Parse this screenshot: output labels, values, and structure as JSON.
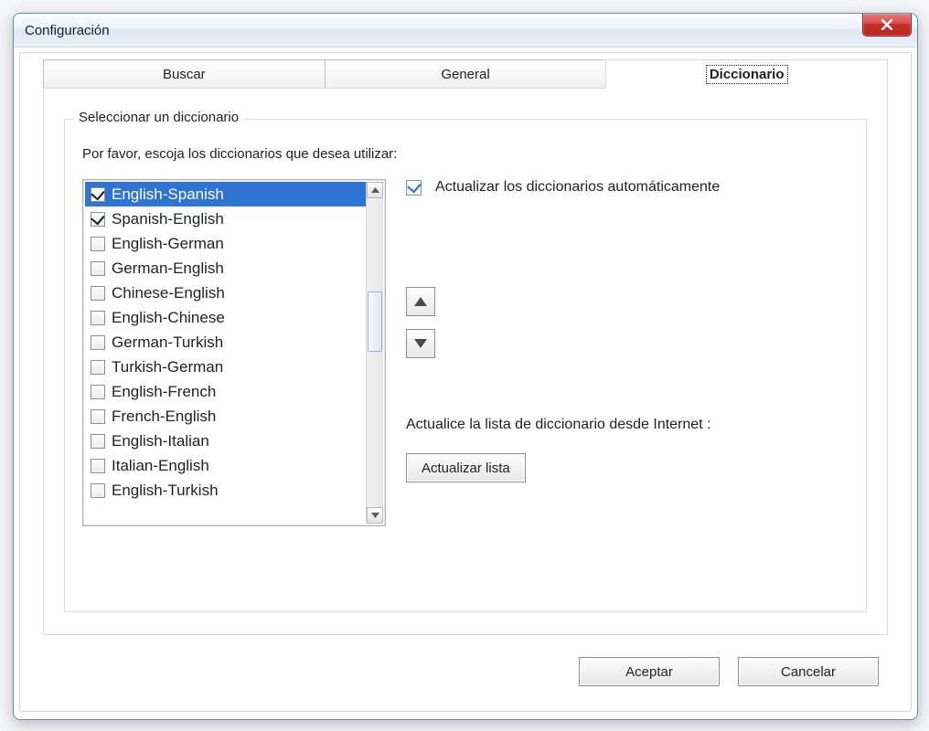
{
  "window": {
    "title": "Configuración"
  },
  "tabs": [
    {
      "label": "Buscar",
      "active": false
    },
    {
      "label": "General",
      "active": false
    },
    {
      "label": "Diccionario",
      "active": true
    }
  ],
  "group": {
    "legend": "Seleccionar un diccionario",
    "instruction": "Por favor, escoja los diccionarios que desea utilizar:"
  },
  "dictionaries": [
    {
      "label": "English-Spanish",
      "checked": true,
      "selected": true
    },
    {
      "label": "Spanish-English",
      "checked": true,
      "selected": false
    },
    {
      "label": "English-German",
      "checked": false,
      "selected": false
    },
    {
      "label": "German-English",
      "checked": false,
      "selected": false
    },
    {
      "label": "Chinese-English",
      "checked": false,
      "selected": false
    },
    {
      "label": "English-Chinese",
      "checked": false,
      "selected": false
    },
    {
      "label": "German-Turkish",
      "checked": false,
      "selected": false
    },
    {
      "label": "Turkish-German",
      "checked": false,
      "selected": false
    },
    {
      "label": "English-French",
      "checked": false,
      "selected": false
    },
    {
      "label": "French-English",
      "checked": false,
      "selected": false
    },
    {
      "label": "English-Italian",
      "checked": false,
      "selected": false
    },
    {
      "label": "Italian-English",
      "checked": false,
      "selected": false
    },
    {
      "label": "English-Turkish",
      "checked": false,
      "selected": false
    }
  ],
  "auto_update": {
    "label": "Actualizar los diccionarios automáticamente",
    "checked": true
  },
  "update_from_internet": {
    "label": "Actualice la lista de diccionario desde Internet :",
    "button": "Actualizar  lista"
  },
  "buttons": {
    "ok": "Aceptar",
    "cancel": "Cancelar"
  }
}
